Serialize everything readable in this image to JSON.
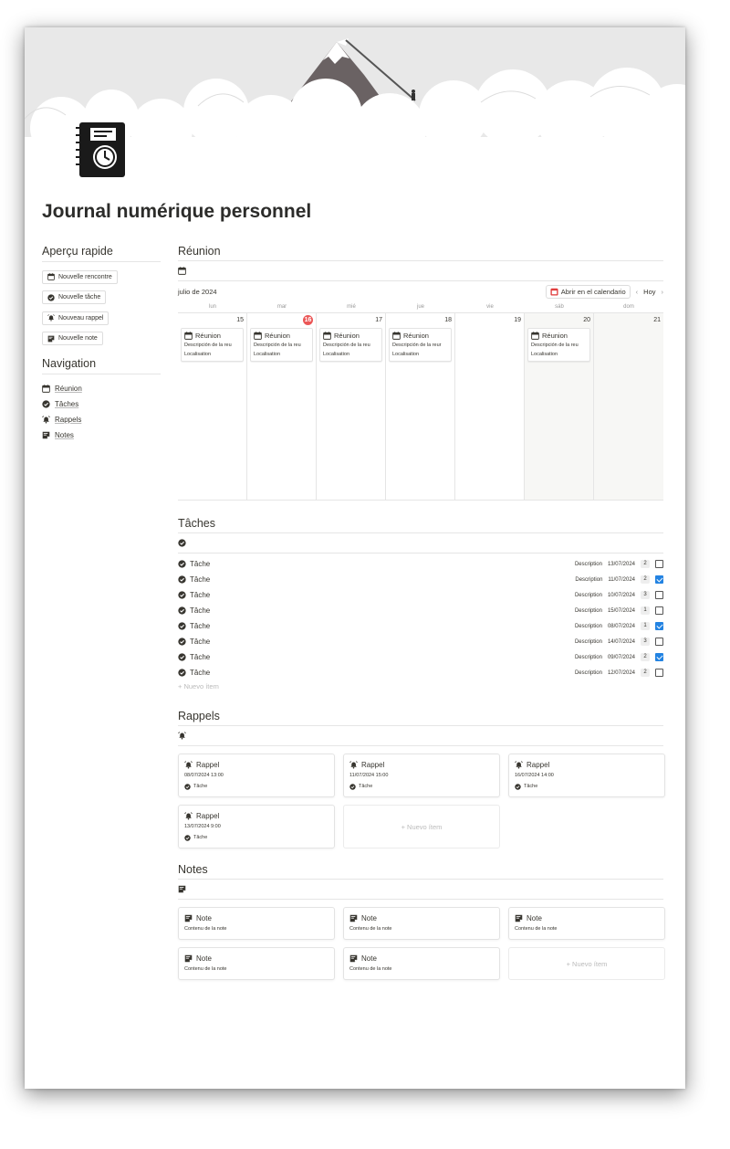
{
  "title": "Journal numérique personnel",
  "quick": {
    "heading": "Aperçu rapide",
    "buttons": [
      "Nouvelle rencontre",
      "Nouvelle tâche",
      "Nouveau rappel",
      "Nouvelle note"
    ]
  },
  "nav": {
    "heading": "Navigation",
    "items": [
      "Réunion",
      "Tâches",
      "Rappels",
      "Notes"
    ]
  },
  "calendar": {
    "heading": "Réunion",
    "month": "julio de 2024",
    "open_label": "Abrir en el calendario",
    "today_label": "Hoy",
    "prev": "‹",
    "next": "›",
    "weekdays": [
      "lun",
      "mar",
      "mié",
      "jue",
      "vie",
      "sáb",
      "dom"
    ],
    "days": [
      "15",
      "16",
      "17",
      "18",
      "19",
      "20",
      "21"
    ],
    "today_index": 1,
    "events": [
      {
        "title": "Réunion",
        "desc": "Descripción de la reu",
        "loc": "Localisation"
      },
      {
        "title": "Réunion",
        "desc": "Descripción de la reu",
        "loc": "Localisation"
      },
      {
        "title": "Réunion",
        "desc": "Descripción de la reu",
        "loc": "Localisation"
      },
      {
        "title": "Réunion",
        "desc": "Descripción de la reur",
        "loc": "Localisation"
      },
      null,
      {
        "title": "Réunion",
        "desc": "Descripción de la reu",
        "loc": "Localisation"
      },
      null
    ]
  },
  "tasks": {
    "heading": "Tâches",
    "rows": [
      {
        "name": "Tâche",
        "desc": "Description",
        "date": "13/07/2024",
        "num": "2",
        "done": false
      },
      {
        "name": "Tâche",
        "desc": "Description",
        "date": "11/07/2024",
        "num": "2",
        "done": true
      },
      {
        "name": "Tâche",
        "desc": "Description",
        "date": "10/07/2024",
        "num": "3",
        "done": false
      },
      {
        "name": "Tâche",
        "desc": "Description",
        "date": "15/07/2024",
        "num": "1",
        "done": false
      },
      {
        "name": "Tâche",
        "desc": "Description",
        "date": "08/07/2024",
        "num": "1",
        "done": true
      },
      {
        "name": "Tâche",
        "desc": "Description",
        "date": "14/07/2024",
        "num": "3",
        "done": false
      },
      {
        "name": "Tâche",
        "desc": "Description",
        "date": "09/07/2024",
        "num": "2",
        "done": true
      },
      {
        "name": "Tâche",
        "desc": "Description",
        "date": "12/07/2024",
        "num": "2",
        "done": false
      }
    ],
    "new_item": "+ Nuevo ítem"
  },
  "reminders": {
    "heading": "Rappels",
    "cards": [
      {
        "title": "Rappel",
        "date": "08/07/2024 13:00",
        "rel": "Tâche"
      },
      {
        "title": "Rappel",
        "date": "11/07/2024 15:00",
        "rel": "Tâche"
      },
      {
        "title": "Rappel",
        "date": "16/07/2024 14:00",
        "rel": "Tâche"
      },
      {
        "title": "Rappel",
        "date": "13/07/2024 9:00",
        "rel": "Tâche"
      }
    ],
    "new_item": "+ Nuevo ítem"
  },
  "notes": {
    "heading": "Notes",
    "cards": [
      {
        "title": "Note",
        "content": "Contenu de la note"
      },
      {
        "title": "Note",
        "content": "Contenu de la note"
      },
      {
        "title": "Note",
        "content": "Contenu de la note"
      },
      {
        "title": "Note",
        "content": "Contenu de la note"
      },
      {
        "title": "Note",
        "content": "Contenu de la note"
      }
    ],
    "new_item": "+ Nuevo ítem"
  },
  "colors": {
    "today": "#eb5757",
    "checkbox": "#2383e2",
    "open_calendar_icon": "#e03e3e"
  }
}
